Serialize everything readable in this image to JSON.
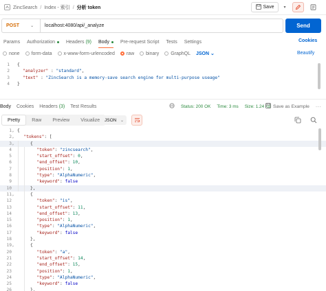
{
  "breadcrumb": {
    "collection": "ZincSearch",
    "folder": "Index - 索引",
    "request": "分析 token",
    "sep": "/"
  },
  "toolbar": {
    "save_label": "Save"
  },
  "request": {
    "method": "POST",
    "url": "localhost:4080/api/_analyze",
    "send_label": "Send"
  },
  "req_tabs": [
    {
      "label": "Params",
      "count": "",
      "dot": false,
      "active": false
    },
    {
      "label": "Authorization",
      "count": "",
      "dot": true,
      "active": false
    },
    {
      "label": "Headers",
      "count": "(9)",
      "dot": false,
      "active": false
    },
    {
      "label": "Body",
      "count": "",
      "dot": true,
      "active": true
    },
    {
      "label": "Pre-request Script",
      "count": "",
      "dot": false,
      "active": false
    },
    {
      "label": "Tests",
      "count": "",
      "dot": false,
      "active": false
    },
    {
      "label": "Settings",
      "count": "",
      "dot": false,
      "active": false
    }
  ],
  "cookies_label": "Cookies",
  "body_types": {
    "none": "none",
    "form_data": "form-data",
    "urlencoded": "x-www-form-urlencoded",
    "raw": "raw",
    "binary": "binary",
    "graphql": "GraphQL",
    "language": "JSON",
    "selected": "raw"
  },
  "beautify_label": "Beautify",
  "request_body": {
    "lines": [
      "1",
      "2",
      "3",
      "4"
    ],
    "open": "{",
    "k1": "\"analyzer\"",
    "v1": "\"standard\"",
    "k2": "\"text\"",
    "v2": "\"ZincSearch is a memory-save search engine for multi-purpose useage\"",
    "close": "}"
  },
  "resp_tabs": {
    "body": "Body",
    "cookies": "Cookies",
    "headers": "Headers",
    "headers_count": "(3)",
    "tests": "Test Results"
  },
  "resp_status": {
    "status": "Status: 200 OK",
    "time": "Time: 3 ms",
    "size": "Size: 1.24 KB"
  },
  "save_example_label": "Save as Example",
  "view_tabs": [
    "Pretty",
    "Raw",
    "Preview",
    "Visualize"
  ],
  "format_label": "JSON",
  "response_tokens": [
    {
      "token": "\"zincsearch\"",
      "start_offset": "0",
      "end_offset": "10",
      "position": "1",
      "type": "\"AlphaNumeric\"",
      "keyword": "false"
    },
    {
      "token": "\"is\"",
      "start_offset": "11",
      "end_offset": "13",
      "position": "1",
      "type": "\"AlphaNumeric\"",
      "keyword": "false"
    },
    {
      "token": "\"a\"",
      "start_offset": "14",
      "end_offset": "15",
      "position": "1",
      "type": "\"AlphaNumeric\"",
      "keyword": "false"
    }
  ],
  "response_keys": {
    "tokens": "\"tokens\"",
    "token": "\"token\"",
    "start_offset": "\"start_offset\"",
    "end_offset": "\"end_offset\"",
    "position": "\"position\"",
    "type": "\"type\"",
    "keyword": "\"keyword\""
  },
  "colors": {
    "send": "#0265d2",
    "accent": "#ff6c37",
    "method": "#d46a00",
    "ok": "#2b8a3e"
  }
}
